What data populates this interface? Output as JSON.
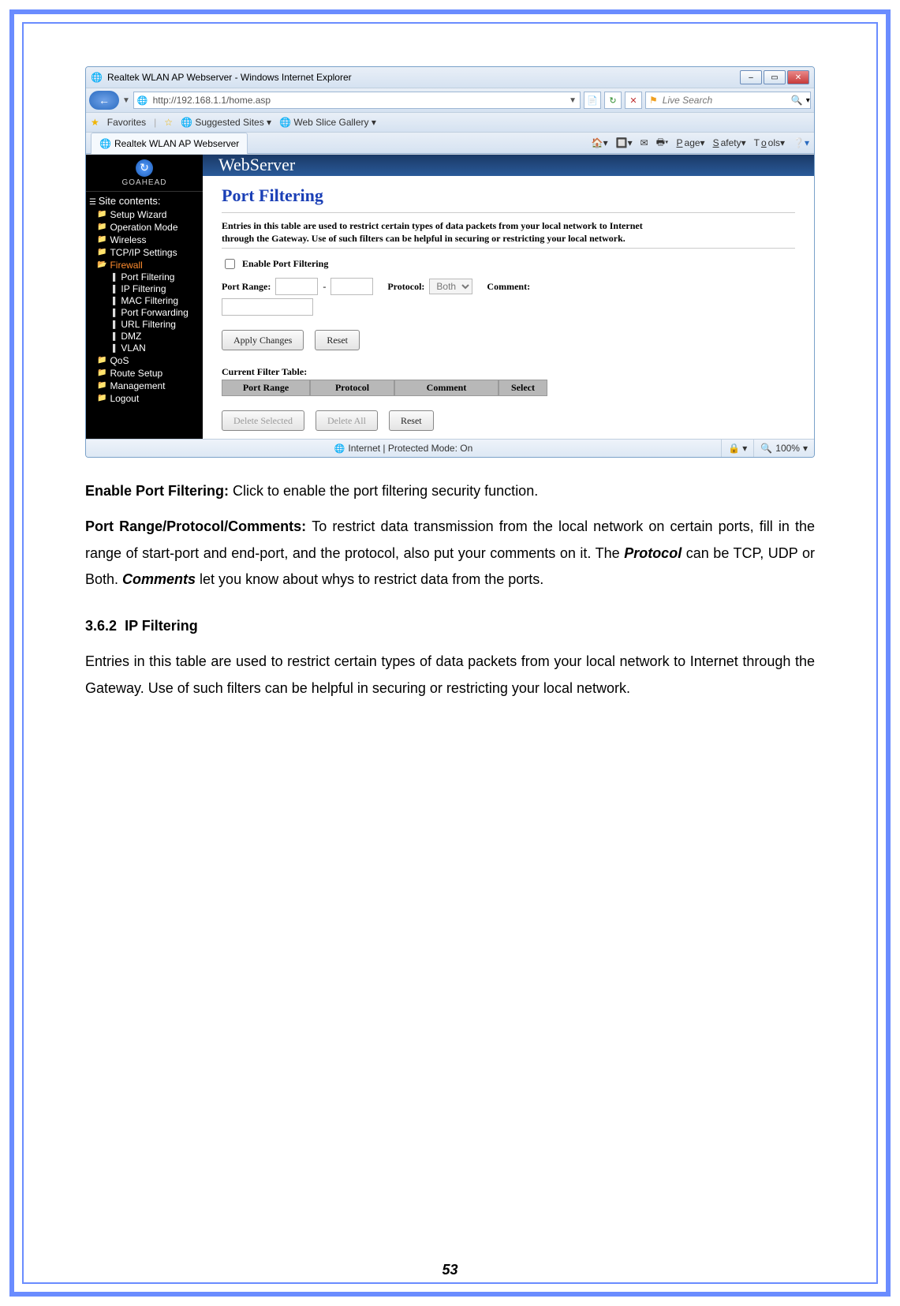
{
  "page_number": "53",
  "window": {
    "title": "Realtek WLAN AP Webserver - Windows Internet Explorer",
    "url": "http://192.168.1.1/home.asp",
    "search_placeholder": "Live Search",
    "favorites_label": "Favorites",
    "suggested_sites": "Suggested Sites",
    "web_slice": "Web Slice Gallery",
    "tab_title": "Realtek WLAN AP Webserver",
    "menu": {
      "page": "Page",
      "safety": "Safety",
      "tools": "Tools"
    },
    "status": {
      "mode": "Internet | Protected Mode: On",
      "zoom": "100%"
    }
  },
  "sidebar": {
    "brand": "GOAHEAD",
    "root": "Site contents:",
    "items": [
      {
        "label": "Setup Wizard",
        "type": "folder"
      },
      {
        "label": "Operation Mode",
        "type": "folder"
      },
      {
        "label": "Wireless",
        "type": "folder"
      },
      {
        "label": "TCP/IP Settings",
        "type": "folder"
      },
      {
        "label": "Firewall",
        "type": "folder",
        "selected": true
      },
      {
        "label": "Port Filtering",
        "type": "leaf"
      },
      {
        "label": "IP Filtering",
        "type": "leaf"
      },
      {
        "label": "MAC Filtering",
        "type": "leaf"
      },
      {
        "label": "Port Forwarding",
        "type": "leaf"
      },
      {
        "label": "URL Filtering",
        "type": "leaf"
      },
      {
        "label": "DMZ",
        "type": "leaf"
      },
      {
        "label": "VLAN",
        "type": "leaf"
      },
      {
        "label": "QoS",
        "type": "folder"
      },
      {
        "label": "Route Setup",
        "type": "folder"
      },
      {
        "label": "Management",
        "type": "folder"
      },
      {
        "label": "Logout",
        "type": "folder"
      }
    ]
  },
  "main": {
    "banner": "WebServer",
    "heading": "Port Filtering",
    "description": "Entries in this table are used to restrict certain types of data packets from your local network to Internet through the Gateway. Use of such filters can be helpful in securing or restricting your local network.",
    "enable_label": "Enable Port Filtering",
    "port_range_label": "Port Range:",
    "protocol_label": "Protocol:",
    "protocol_value": "Both",
    "comment_label": "Comment:",
    "buttons": {
      "apply": "Apply Changes",
      "reset": "Reset",
      "delete_selected": "Delete Selected",
      "delete_all": "Delete All",
      "reset2": "Reset"
    },
    "table_caption": "Current Filter Table:",
    "table_headers": {
      "c1": "Port Range",
      "c2": "Protocol",
      "c3": "Comment",
      "c4": "Select"
    }
  },
  "doc": {
    "p1_bold": "Enable Port Filtering: ",
    "p1_rest": "Click to enable the port filtering security function.",
    "p2_bold": "Port Range/Protocol/Comments: ",
    "p2_rest": "To restrict data transmission from the local network on certain ports, fill in the range of start-port and end-port, and the protocol, also put your comments on it. The ",
    "p2_italic1": "Protocol",
    "p2_mid": " can be TCP, UDP or Both. ",
    "p2_italic2": "Comments",
    "p2_tail": " let you know about whys to restrict data from the ports.",
    "sec_num": "3.6.2",
    "sec_title": "IP Filtering",
    "p3": "Entries in this table are used to restrict certain types of data packets from your local network to Internet through the Gateway. Use of such filters can be helpful in securing or restricting your local network."
  }
}
